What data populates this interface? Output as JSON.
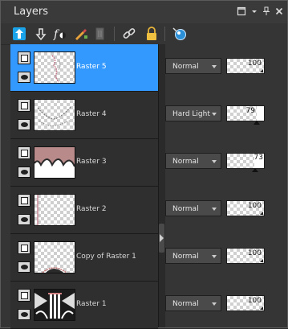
{
  "panel": {
    "title": "Layers"
  },
  "toolbar": {
    "icons": [
      "new-raster-layer-icon",
      "new-vector-layer-icon",
      "new-adjustment-layer-icon",
      "new-mask-layer-icon",
      "delete-layer-icon",
      "link-icon",
      "lock-icon",
      "layer-properties-icon"
    ]
  },
  "layers": [
    {
      "name": "Raster 5",
      "blend": "Normal",
      "opacity": "100",
      "selected": true
    },
    {
      "name": "Raster 4",
      "blend": "Hard Light",
      "opacity": "79",
      "selected": false
    },
    {
      "name": "Raster 3",
      "blend": "Normal",
      "opacity": "73",
      "selected": false
    },
    {
      "name": "Raster 2",
      "blend": "Normal",
      "opacity": "100",
      "selected": false
    },
    {
      "name": "Copy of Raster 1",
      "blend": "Normal",
      "opacity": "100",
      "selected": false
    },
    {
      "name": "Raster 1",
      "blend": "Normal",
      "opacity": "100",
      "selected": false
    }
  ],
  "colors": {
    "selection": "#3399ff",
    "panel": "#353535",
    "list": "#1e1e1e"
  }
}
